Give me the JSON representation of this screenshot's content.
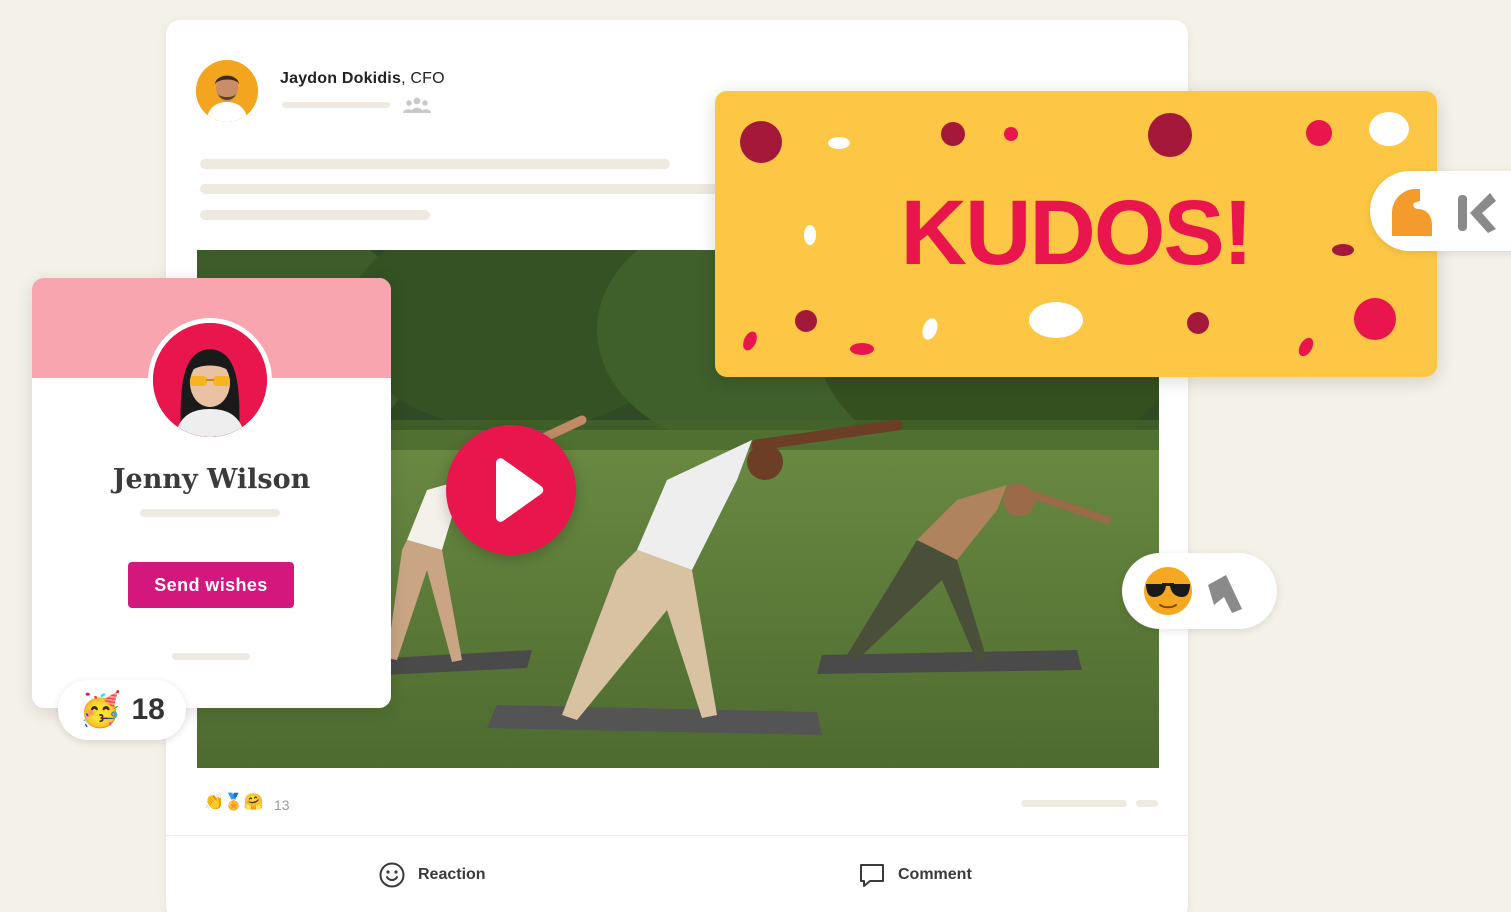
{
  "post": {
    "author_name": "Jaydon Dokidis",
    "author_title": "CFO",
    "reactions": {
      "emojis": "👏🏅🤗",
      "count": "13"
    },
    "actions": {
      "reaction_label": "Reaction",
      "comment_label": "Comment"
    }
  },
  "profile": {
    "name": "Jenny Wilson",
    "button_label": "Send wishes",
    "reaction_emoji": "🥳",
    "reaction_count": "18"
  },
  "kudos": {
    "text": "KUDOS!"
  },
  "colors": {
    "accent": "#e8164d",
    "button": "#d3177c",
    "kudos_background": "#fdc745",
    "profile_banner": "#f8a5b0",
    "page_background": "#f4f1e8"
  },
  "icons": {
    "play": "play-icon",
    "group": "group-icon",
    "reaction": "smiley-icon",
    "comment": "comment-bubble-icon",
    "muscle": "flexed-biceps-icon",
    "cool": "sunglasses-face-icon",
    "cursor": "cursor-arrow-icon"
  }
}
